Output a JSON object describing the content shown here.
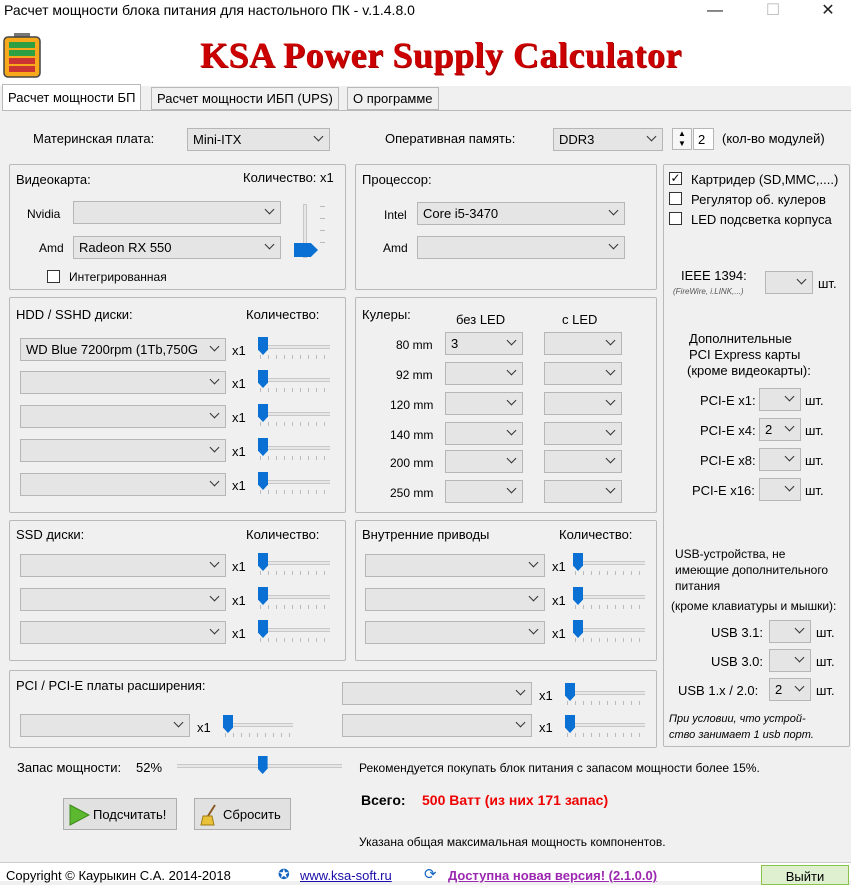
{
  "window": {
    "title": "Расчет мощности блока питания для настольного ПК - v.1.4.8.0",
    "min": "—",
    "max": "☐",
    "close": "✕"
  },
  "banner": {
    "brand": "KSA Power Supply Calculator"
  },
  "tabs": [
    "Расчет мощности БП",
    "Расчет мощности ИБП (UPS)",
    "О программе"
  ],
  "mb": {
    "label": "Материнская плата:",
    "value": "Mini-ITX"
  },
  "ram": {
    "label": "Оперативная память:",
    "value": "DDR3",
    "count": "2",
    "count_note": "(кол-во модулей)"
  },
  "gpu": {
    "title": "Видеокарта:",
    "qty_label": "Количество: x1",
    "nvidia": "Nvidia",
    "amd": "Amd",
    "amd_value": "Radeon RX 550",
    "integrated": "Интегрированная"
  },
  "cpu": {
    "title": "Процессор:",
    "intel": "Intel",
    "intel_value": "Core i5-3470",
    "amd": "Amd"
  },
  "extras": {
    "cardreader": "Картридер (SD,MMC,....)",
    "fan_ctrl": "Регулятор об. кулеров",
    "led": "LED подсветка корпуса",
    "ieee": "IEEE 1394:",
    "ieee_sub": "(FireWire, i.LINK,...)",
    "unit": "шт."
  },
  "hdd": {
    "title": "HDD / SSHD диски:",
    "qty_label": "Количество:",
    "first_value": "WD Blue 7200rpm (1Tb,750G",
    "mult": "x1"
  },
  "coolers": {
    "title": "Кулеры:",
    "no_led": "без LED",
    "led": "с LED",
    "sizes": [
      "80 mm",
      "92 mm",
      "120 mm",
      "140 mm",
      "200 mm",
      "250 mm"
    ],
    "first_value": "3"
  },
  "pcie": {
    "title_lines": [
      "Дополнительные",
      "PCI Express карты",
      "(кроме видеокарты):"
    ],
    "rows": [
      {
        "label": "PCI-E x1:",
        "value": ""
      },
      {
        "label": "PCI-E x4:",
        "value": "2"
      },
      {
        "label": "PCI-E x8:",
        "value": ""
      },
      {
        "label": "PCI-E x16:",
        "value": ""
      }
    ]
  },
  "ssd": {
    "title": "SSD диски:",
    "qty_label": "Количество:",
    "mult": "x1"
  },
  "drives": {
    "title": "Внутренние приводы",
    "qty_label": "Количество:",
    "mult": "x1"
  },
  "usb": {
    "title_lines": [
      "USB-устройства, не",
      "имеющие дополнительного",
      "питания",
      "(кроме клавиатуры и мышки):"
    ],
    "rows": [
      {
        "label": "USB 3.1:",
        "value": ""
      },
      {
        "label": "USB 3.0:",
        "value": ""
      },
      {
        "label": "USB 1.x / 2.0:",
        "value": "2"
      }
    ],
    "note_lines": [
      "При условии, что устрой-",
      "ство занимает 1 usb порт."
    ]
  },
  "pci": {
    "title": "PCI / PCI-E платы расширения:",
    "mult": "x1"
  },
  "reserve": {
    "label": "Запас мощности:",
    "value": "52%",
    "level": 0.52,
    "note": "Рекомендуется покупать блок питания с запасом мощности более 15%."
  },
  "result": {
    "label": "Всего:",
    "value": "500 Ватт (из них 171 запас)",
    "note": "Указана общая максимальная мощность компонентов."
  },
  "buttons": {
    "calc": "Подсчитать!",
    "reset": "Сбросить",
    "exit": "Выйти"
  },
  "status": {
    "copyright": "Copyright © Каурыкин С.А. 2014-2018",
    "site": "www.ksa-soft.ru",
    "update": "Доступна новая версия! (2.1.0.0)"
  }
}
